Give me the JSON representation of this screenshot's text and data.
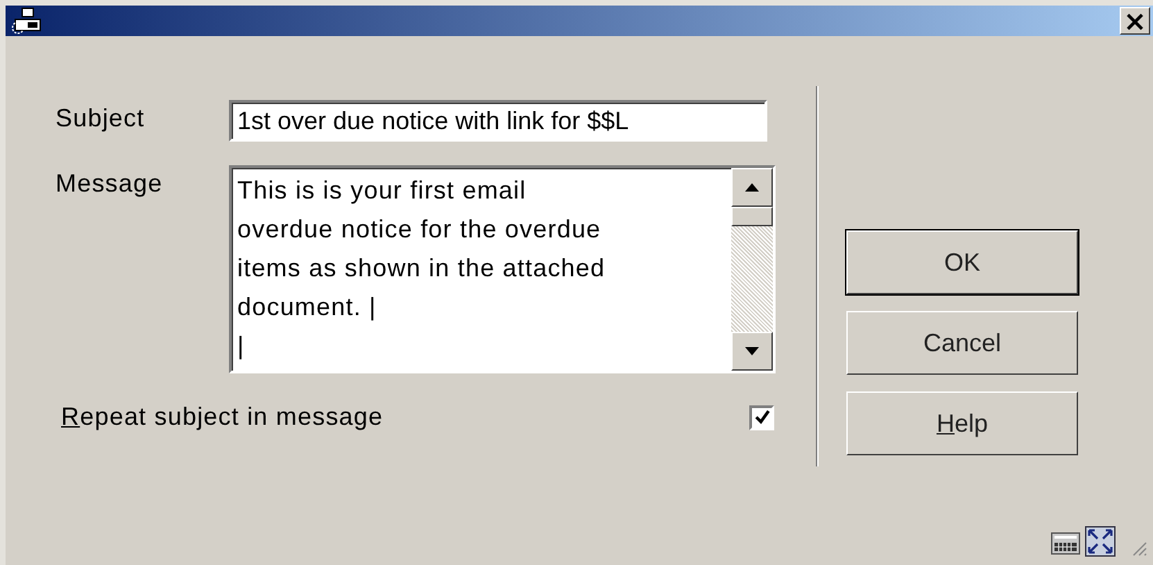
{
  "window": {
    "close_label": "×"
  },
  "subject": {
    "label": "Subject",
    "value": "1st over due notice with link for $$L"
  },
  "message": {
    "label": "Message",
    "lines": [
      "This is is your first email",
      "overdue notice for the overdue",
      "items as shown in the attached",
      "document.  |",
      "|"
    ]
  },
  "repeat_subject": {
    "label": "Repeat subject in message",
    "access_key_first": true,
    "checked": true
  },
  "buttons": [
    {
      "label": "OK",
      "default": true,
      "access_key_first": false
    },
    {
      "label": "Cancel",
      "default": false,
      "access_key_first": false
    },
    {
      "label": "Help",
      "default": false,
      "access_key_first": true
    }
  ]
}
